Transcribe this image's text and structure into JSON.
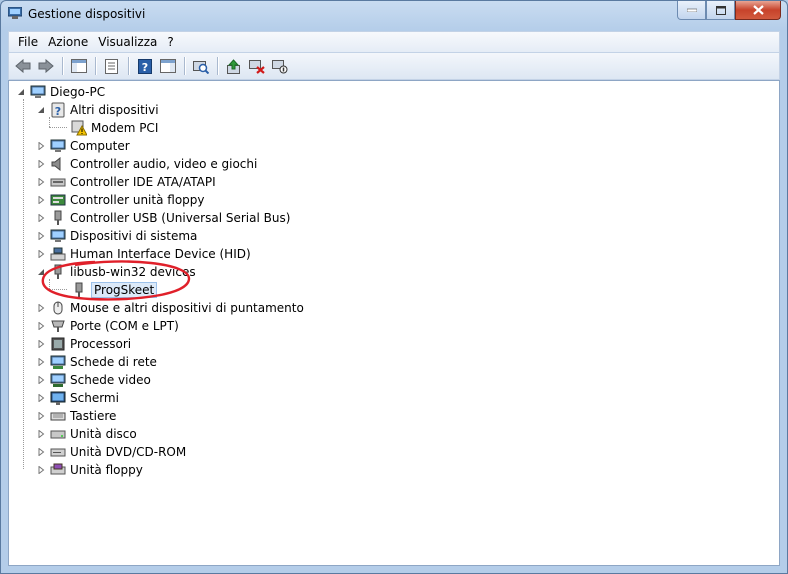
{
  "window": {
    "title": "Gestione dispositivi"
  },
  "menu": {
    "file": "File",
    "azione": "Azione",
    "visualizza": "Visualizza",
    "help": "?"
  },
  "tree": {
    "root": "Diego-PC",
    "altri": "Altri dispositivi",
    "modem": "Modem PCI",
    "computer": "Computer",
    "audio": "Controller audio, video e giochi",
    "ide": "Controller IDE ATA/ATAPI",
    "floppy_ctrl": "Controller unità floppy",
    "usb": "Controller USB (Universal Serial Bus)",
    "sistema": "Dispositivi di sistema",
    "hid": "Human Interface Device (HID)",
    "libusb": "libusb-win32 devices",
    "progskeet": "ProgSkeet",
    "mouse": "Mouse e altri dispositivi di puntamento",
    "porte": "Porte (COM e LPT)",
    "processori": "Processori",
    "rete": "Schede di rete",
    "video": "Schede video",
    "schermi": "Schermi",
    "tastiere": "Tastiere",
    "disco": "Unità disco",
    "dvd": "Unità DVD/CD-ROM",
    "floppy": "Unità floppy"
  },
  "colors": {
    "annotation": "#e0202a",
    "selection": "#dceaf9"
  }
}
